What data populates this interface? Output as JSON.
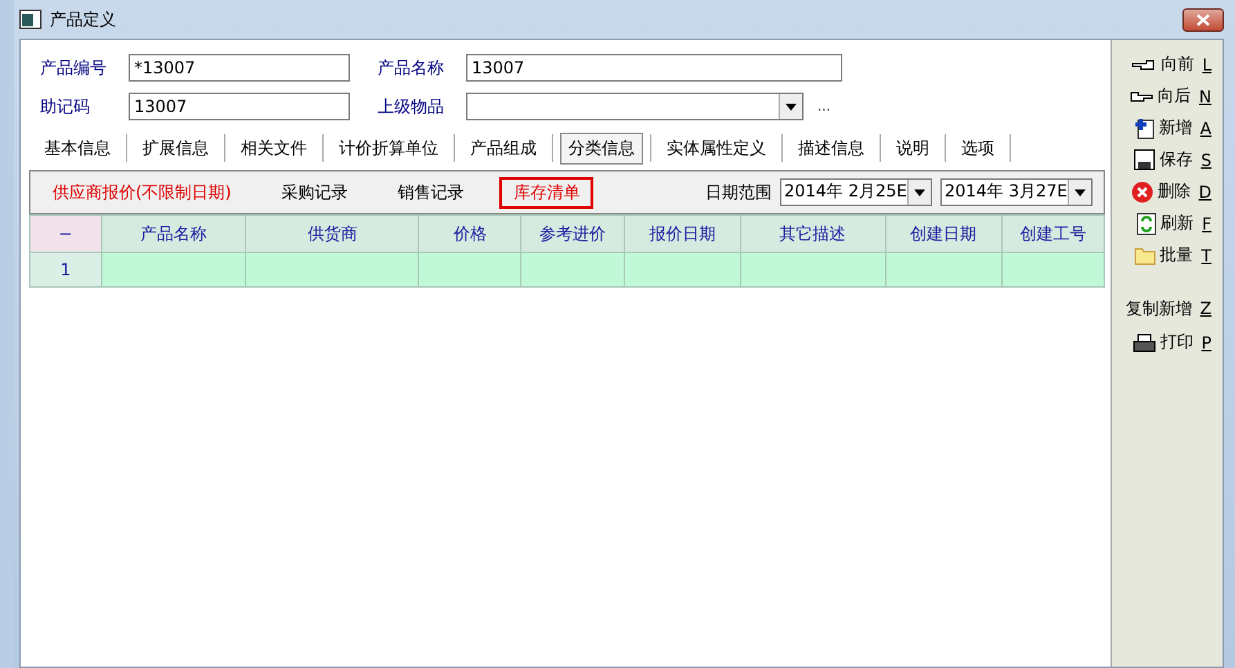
{
  "window": {
    "title": "产品定义"
  },
  "form": {
    "code_label": "产品编号",
    "code_value": "*13007",
    "name_label": "产品名称",
    "name_value": "13007",
    "mnemonic_label": "助记码",
    "mnemonic_value": "13007",
    "parent_label": "上级物品",
    "more": "..."
  },
  "tabs": [
    {
      "label": "基本信息",
      "selected": false
    },
    {
      "label": "扩展信息",
      "selected": false
    },
    {
      "label": "相关文件",
      "selected": false
    },
    {
      "label": "计价折算单位",
      "selected": false
    },
    {
      "label": "产品组成",
      "selected": false
    },
    {
      "label": "分类信息",
      "selected": true
    },
    {
      "label": "实体属性定义",
      "selected": false
    },
    {
      "label": "描述信息",
      "selected": false
    },
    {
      "label": "说明",
      "selected": false
    },
    {
      "label": "选项",
      "selected": false
    }
  ],
  "subtabs": [
    {
      "label": "供应商报价(不限制日期)",
      "color": "#e00000",
      "focused": false
    },
    {
      "label": "采购记录",
      "color": "#000000",
      "focused": false
    },
    {
      "label": "销售记录",
      "color": "#000000",
      "focused": false
    },
    {
      "label": "库存清单",
      "color": "#e00000",
      "focused": true
    }
  ],
  "date_range": {
    "label": "日期范围",
    "from": "2014年  2月25E",
    "to": "2014年  3月27E"
  },
  "table": {
    "corner": "−",
    "columns": [
      "产品名称",
      "供货商",
      "价格",
      "参考进价",
      "报价日期",
      "其它描述",
      "创建日期",
      "创建工号"
    ],
    "rows": [
      {
        "index": "1",
        "cells": [
          "",
          "",
          "",
          "",
          "",
          "",
          "",
          ""
        ]
      }
    ]
  },
  "toolbar": [
    {
      "label": "向前",
      "key": "L"
    },
    {
      "label": "向后",
      "key": "N"
    },
    {
      "label": "新增",
      "key": "A"
    },
    {
      "label": "保存",
      "key": "S"
    },
    {
      "label": "删除",
      "key": "D"
    },
    {
      "label": "刷新",
      "key": "F"
    },
    {
      "label": "批量",
      "key": "T"
    },
    {
      "label": "复制新增",
      "key": "Z"
    },
    {
      "label": "打印",
      "key": "P"
    }
  ]
}
